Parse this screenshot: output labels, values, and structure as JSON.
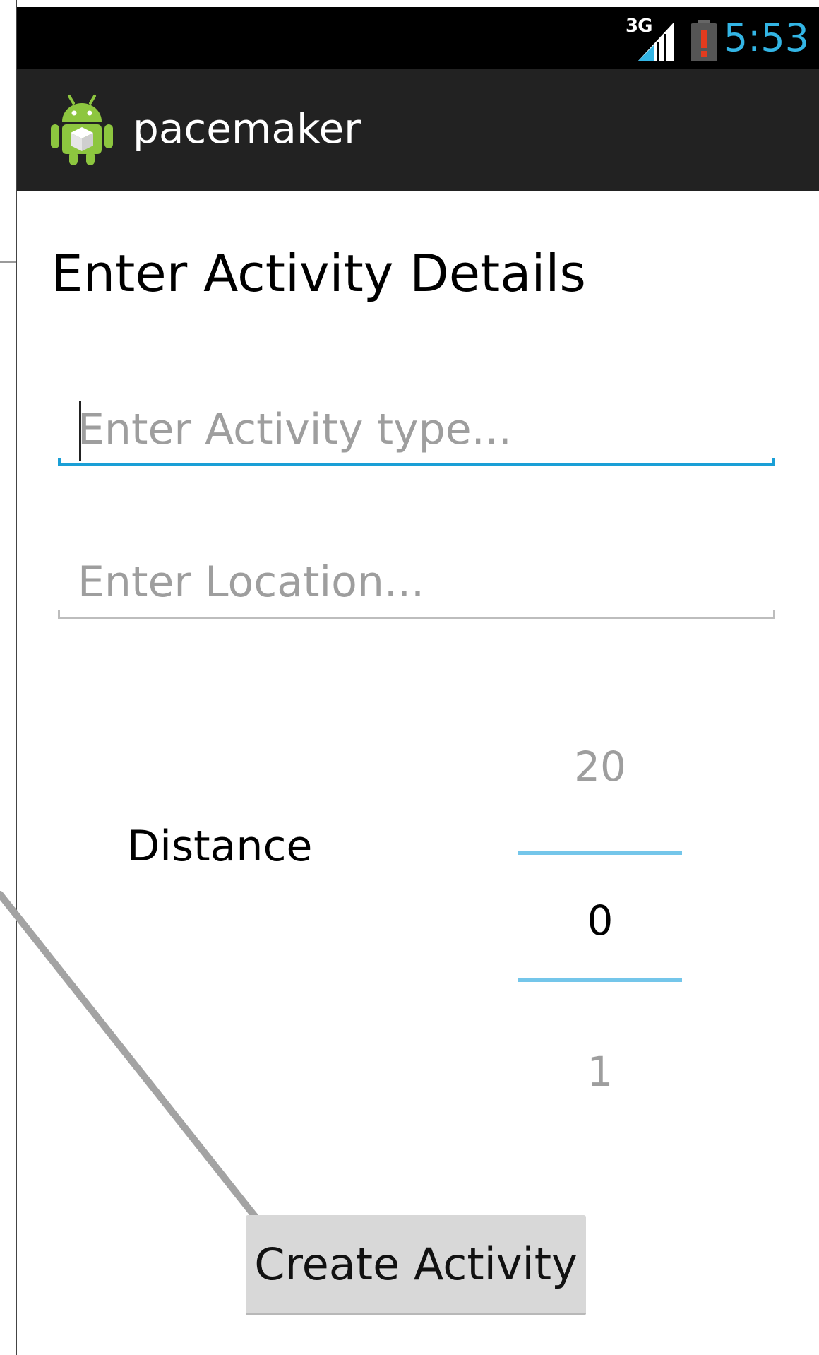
{
  "status_bar": {
    "network": "3G",
    "time": "5:53",
    "time_color": "#33b5e5"
  },
  "action_bar": {
    "title": "pacemaker",
    "icon": "android-robot-icon"
  },
  "form": {
    "heading": "Enter Activity Details",
    "activity_type": {
      "value": "",
      "placeholder": "Enter Activity type..."
    },
    "location": {
      "value": "",
      "placeholder": "Enter Location..."
    },
    "distance": {
      "label": "Distance",
      "previous": "20",
      "current": "0",
      "next": "1"
    },
    "submit_label": "Create Activity"
  },
  "colors": {
    "accent": "#33b5e5",
    "focused_underline": "#1a9fd6",
    "picker_divider": "#74c6ea",
    "action_bar": "#222222",
    "button": "#d8d8d8"
  }
}
